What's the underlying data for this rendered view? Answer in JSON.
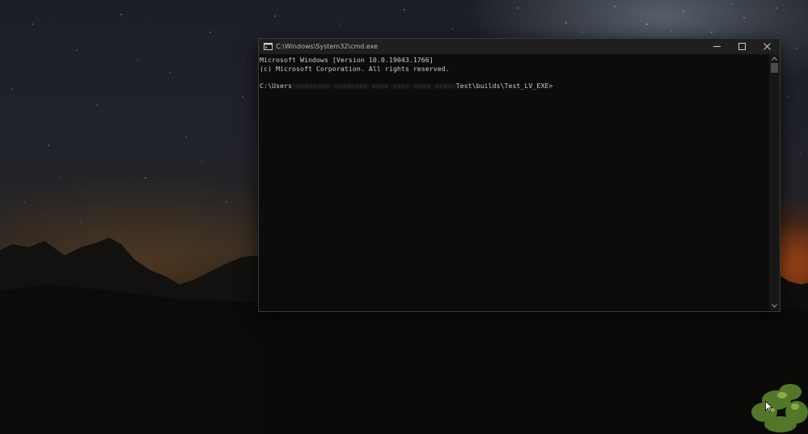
{
  "window": {
    "title": "C:\\Windows\\System32\\cmd.exe",
    "controls": {
      "minimize": "minimize-icon",
      "maximize": "maximize-icon",
      "close": "close-icon"
    }
  },
  "console": {
    "lines": [
      "Microsoft Windows [Version 10.0.19043.1766]",
      "(c) Microsoft Corporation. All rights reserved.",
      "",
      "C:\\Users"
    ],
    "prompt": {
      "prefix": "C:\\Users",
      "redacted": "\\xxxxxxxx-xxxxxxxx-xxxx-xxxx-xxxx-xxxx\\",
      "suffix": "Test\\builds\\Test_LV_EXE>"
    },
    "text_color": "#cccccc",
    "background": "#0c0c0c"
  },
  "colors": {
    "titlebar": "#1f1f1f",
    "sunset_glow": "#dc5a14"
  }
}
